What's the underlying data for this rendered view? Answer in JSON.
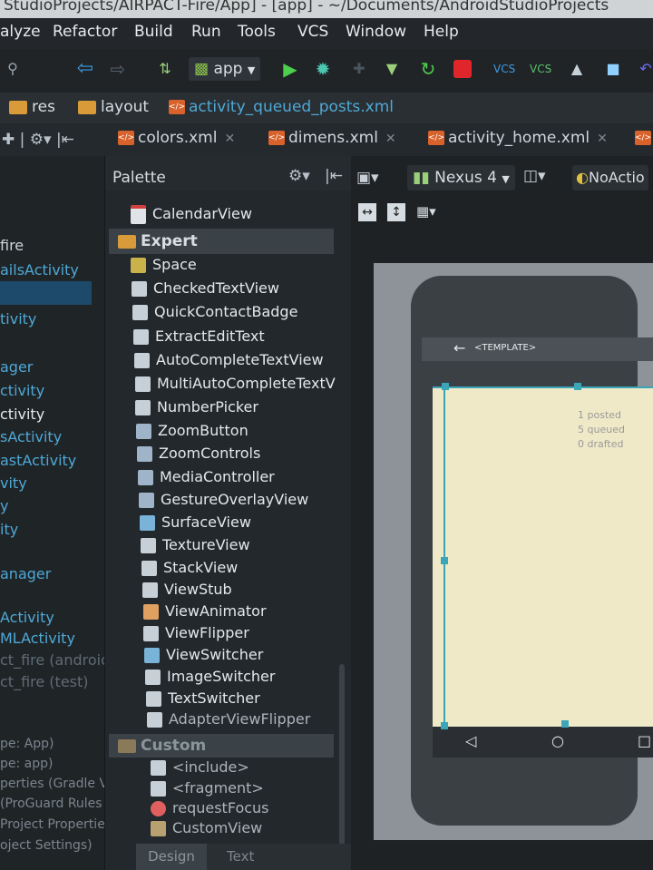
{
  "title_bar": {
    "text": "StudioProjects/AIRPACT-Fire/App] - [app] - ~/Documents/AndroidStudioProjects"
  },
  "menu": {
    "items": [
      "alyze",
      "Refactor",
      "Build",
      "Run",
      "Tools",
      "VCS",
      "Window",
      "Help"
    ]
  },
  "toolbar": {
    "run_config": "app"
  },
  "breadcrumb": {
    "items": [
      "res",
      "layout",
      "activity_queued_posts.xml"
    ]
  },
  "tabs": [
    "colors.xml",
    "dimens.xml",
    "activity_home.xml"
  ],
  "project_panel": {
    "items": [
      "fire",
      "ailsActivity",
      "",
      "tivity",
      "",
      "ager",
      "ctivity",
      "ctivity",
      "sActivity",
      "astActivity",
      "vity",
      "y",
      "ity",
      "",
      "anager",
      "",
      "Activity",
      "MLActivity",
      "ct_fire (android",
      "ct_fire (test)",
      "",
      "",
      "pe: App)",
      "pe: app)",
      "perties (Gradle V",
      "(ProGuard Rules",
      "Project Propertie",
      "oject Settings)"
    ]
  },
  "palette": {
    "title": "Palette",
    "items_top": [
      "CalendarView"
    ],
    "expert_label": "Expert",
    "expert_items": [
      "Space",
      "CheckedTextView",
      "QuickContactBadge",
      "ExtractEditText",
      "AutoCompleteTextView",
      "MultiAutoCompleteTextV",
      "NumberPicker",
      "ZoomButton",
      "ZoomControls",
      "MediaController",
      "GestureOverlayView",
      "SurfaceView",
      "TextureView",
      "StackView",
      "ViewStub",
      "ViewAnimator",
      "ViewFlipper",
      "ViewSwitcher",
      "ImageSwitcher",
      "TextSwitcher",
      "AdapterViewFlipper"
    ],
    "custom_label": "Custom",
    "custom_items": [
      "<include>",
      "<fragment>",
      "requestFocus",
      "CustomView"
    ]
  },
  "design_toolbar": {
    "device": "Nexus 4",
    "theme": "NoActio"
  },
  "preview": {
    "app_title": "<TEMPLATE>",
    "stats": [
      "1 posted",
      "5 queued",
      "0 drafted"
    ]
  },
  "bottom_tabs": [
    "Design",
    "Text"
  ],
  "colors": {
    "accent": "#4fa8d6",
    "selection": "#3aa6b8",
    "screen": "#efe9c8"
  }
}
